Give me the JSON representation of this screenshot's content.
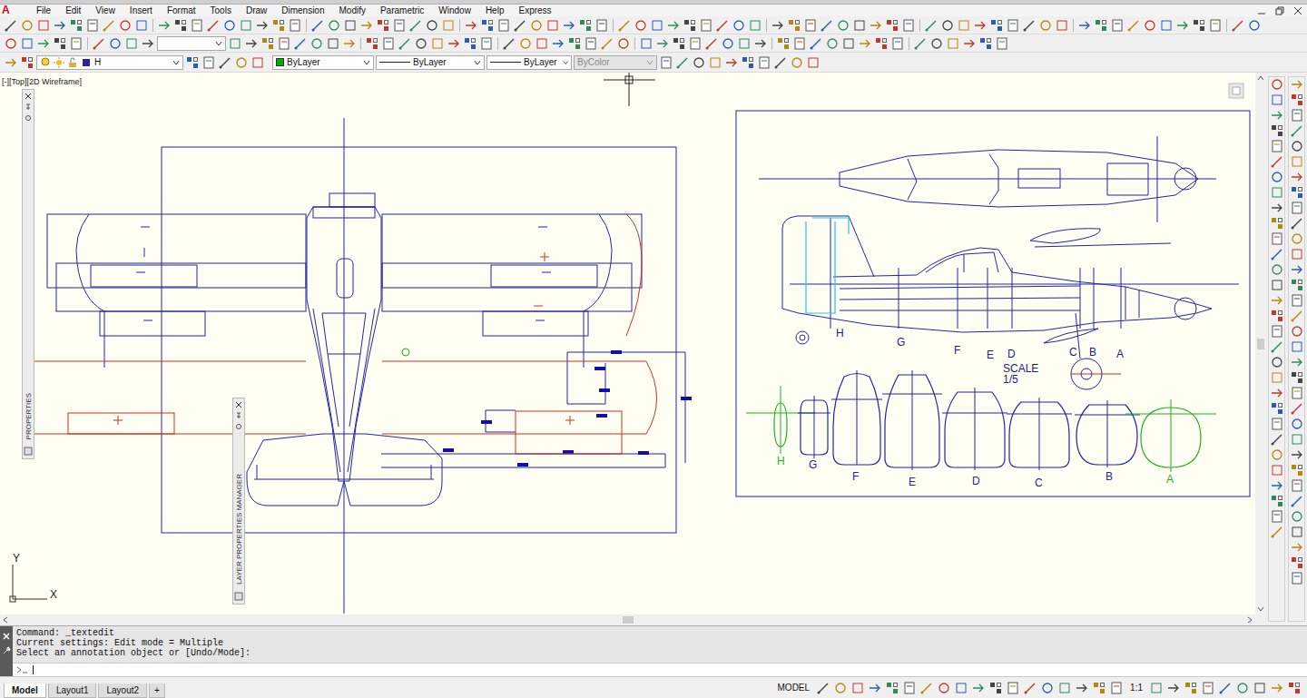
{
  "app": {
    "logo": "A"
  },
  "menu": [
    "File",
    "Edit",
    "View",
    "Insert",
    "Format",
    "Tools",
    "Draw",
    "Dimension",
    "Modify",
    "Parametric",
    "Window",
    "Help",
    "Express"
  ],
  "properties_bar": {
    "layer": "H",
    "color": {
      "label": "ByLayer",
      "swatch": "#00b000"
    },
    "linetype": "ByLayer",
    "lineweight": "ByLayer",
    "plot_style": {
      "label": "ByColor",
      "disabled": true
    }
  },
  "viewport": {
    "label": "[-][Top][2D Wireframe]"
  },
  "palettes": [
    {
      "title": "PROPERTIES"
    },
    {
      "title": "LAYER PROPERTIES MANAGER"
    }
  ],
  "ucs": {
    "x_axis": "X",
    "y_axis": "Y"
  },
  "sheet": {
    "scale_label": "SCALE",
    "scale_value": "1/5",
    "side_stations": [
      "H",
      "G",
      "F",
      "E",
      "D",
      "C",
      "B",
      "A"
    ],
    "sections": [
      {
        "label": "H",
        "color": "#20b020"
      },
      {
        "label": "G",
        "color": "#2424a8"
      },
      {
        "label": "F",
        "color": "#2424a8"
      },
      {
        "label": "E",
        "color": "#2424a8"
      },
      {
        "label": "D",
        "color": "#2424a8"
      },
      {
        "label": "C",
        "color": "#2424a8"
      },
      {
        "label": "B",
        "color": "#2424a8"
      },
      {
        "label": "A",
        "color": "#20b020"
      }
    ]
  },
  "command_line": {
    "history": [
      "Command: _textedit",
      "Current settings: Edit mode = Multiple",
      "Select an annotation object or [Undo/Mode]:"
    ]
  },
  "layout_tabs": [
    {
      "label": "Model",
      "selected": true
    },
    {
      "label": "Layout1",
      "selected": false
    },
    {
      "label": "Layout2",
      "selected": false
    }
  ],
  "add_tab": "+",
  "status_bar": {
    "space": "MODEL",
    "annotation_scale": "1:1"
  }
}
